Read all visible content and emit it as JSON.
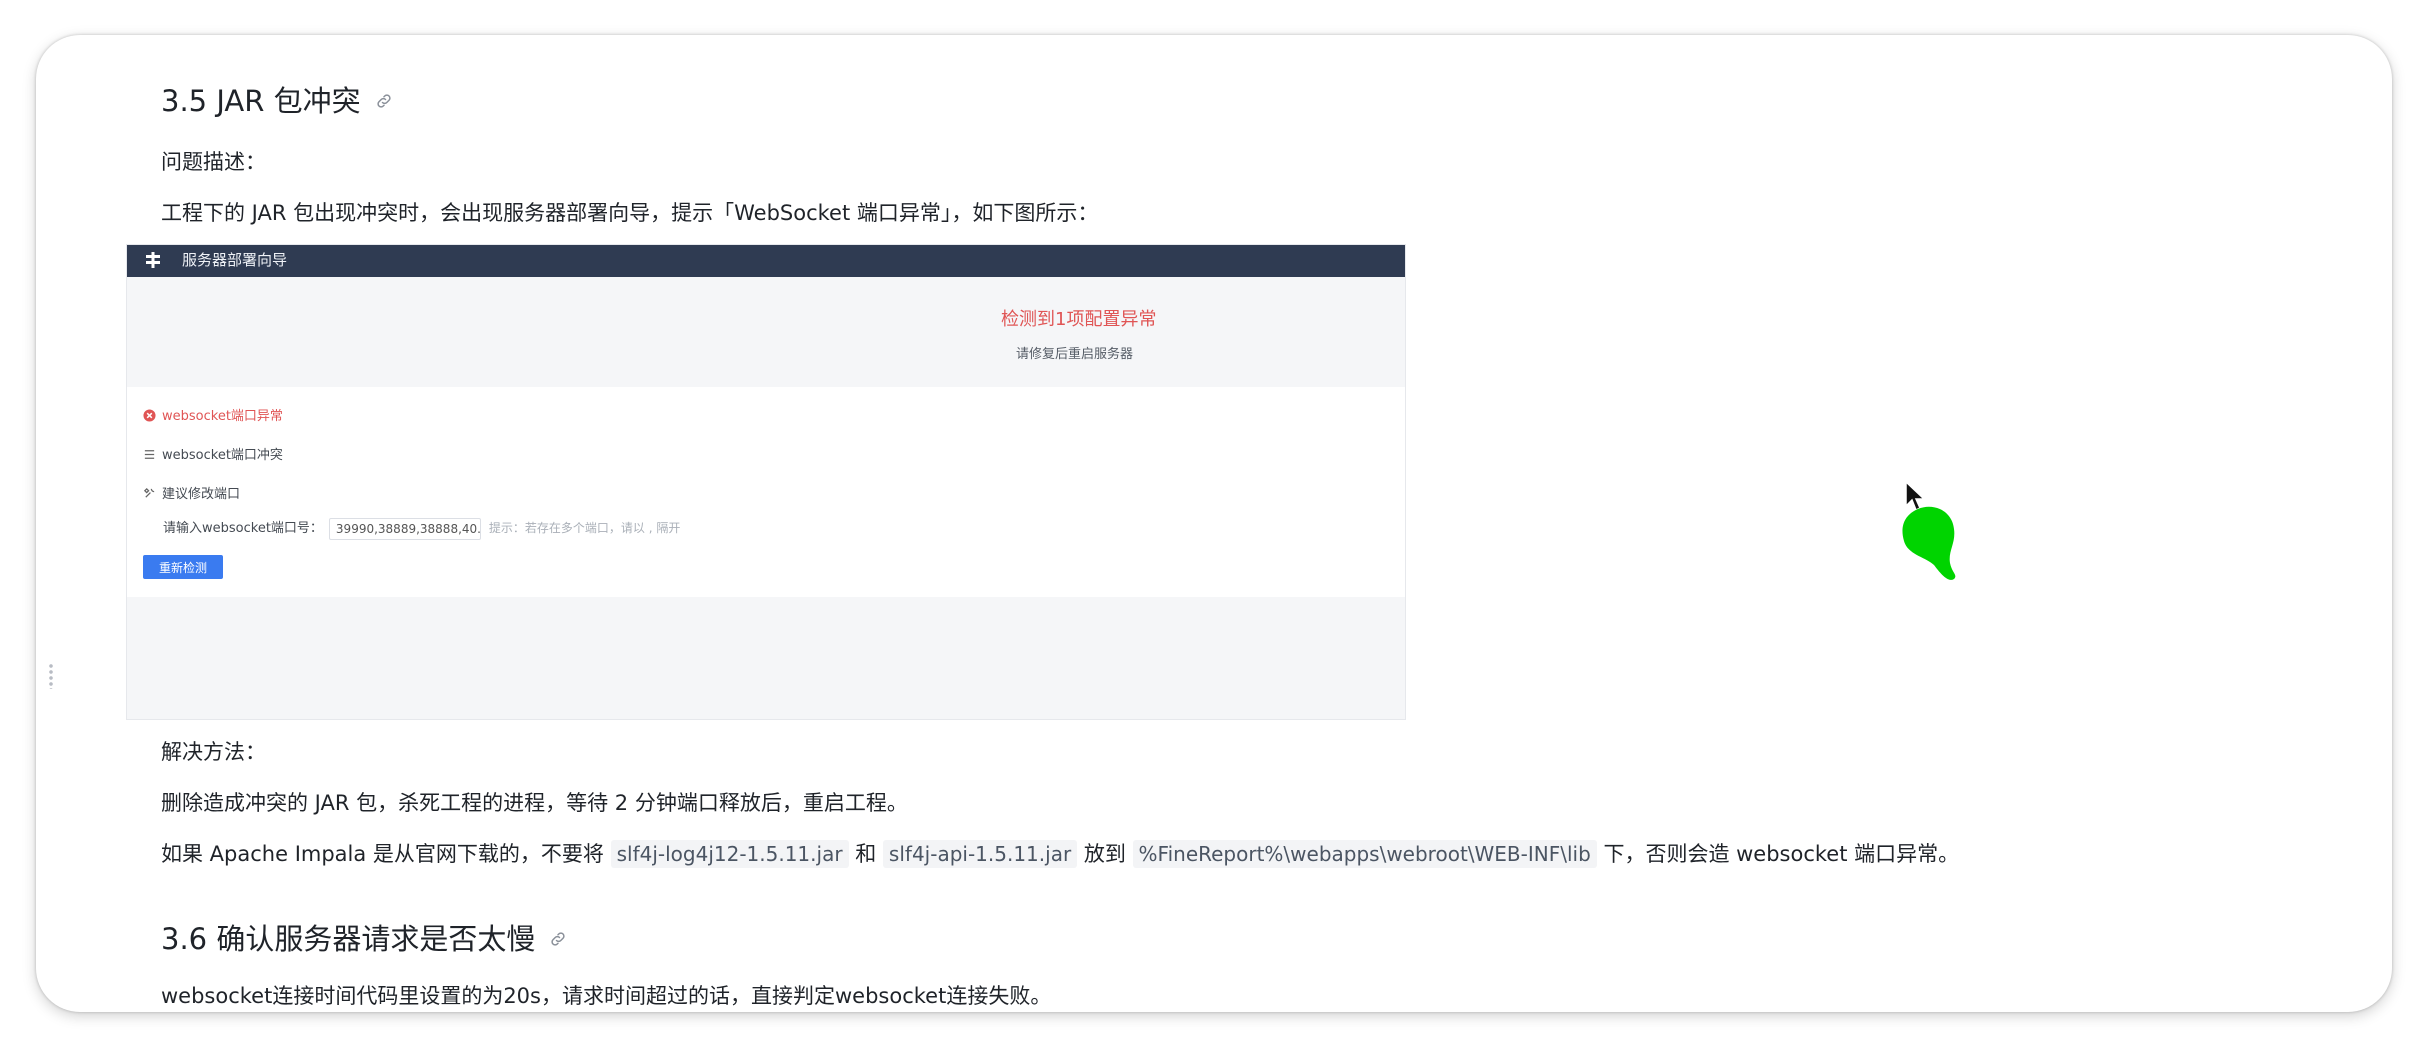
{
  "sections": {
    "s35_title": "3.5 JAR 包冲突",
    "problem_label": "问题描述：",
    "problem_text": "工程下的 JAR 包出现冲突时，会出现服务器部署向导，提示「WebSocket 端口异常」，如下图所示：",
    "solution_label": "解决方法：",
    "solution_text": "删除造成冲突的 JAR 包，杀死工程的进程，等待 2 分钟端口释放后，重启工程。",
    "apache_line": {
      "prefix": "如果 Apache Impala  是从官网下载的，不要将 ",
      "code1": "slf4j-log4j12-1.5.11.jar",
      "mid1": " 和 ",
      "code2": "slf4j-api-1.5.11.jar",
      "mid2": "  放到 ",
      "code3": "%FineReport%\\webapps\\webroot\\WEB-INF\\lib",
      "suffix": " 下，否则会造 websocket 端口异常。"
    },
    "s36_title": "3.6 确认服务器请求是否太慢",
    "s36_text": "websocket连接时间代码里设置的为20s，请求时间超过的话，直接判定websocket连接失败。"
  },
  "embedded_screenshot": {
    "header_title": "服务器部署向导",
    "error_title": "检测到1项配置异常",
    "error_subtitle": "请修复后重启服务器",
    "error_item": "websocket端口异常",
    "conflict_item": "websocket端口冲突",
    "suggest_item": "建议修改端口",
    "port_label": "请输入websocket端口号：",
    "port_value": "39990,38889,38888,40...",
    "port_hint": "提示：若存在多个端口，请以 , 隔开",
    "recheck_button": "重新检测"
  },
  "colors": {
    "error_red": "#e05555",
    "header_navy": "#2f3b52",
    "button_blue": "#3a7bf0",
    "cursor_blob_green": "#00d400"
  },
  "icons": [
    "link-icon",
    "wizard-logo-icon",
    "error-circle-icon",
    "list-icon",
    "wrench-icon",
    "mouse-cursor-icon"
  ]
}
